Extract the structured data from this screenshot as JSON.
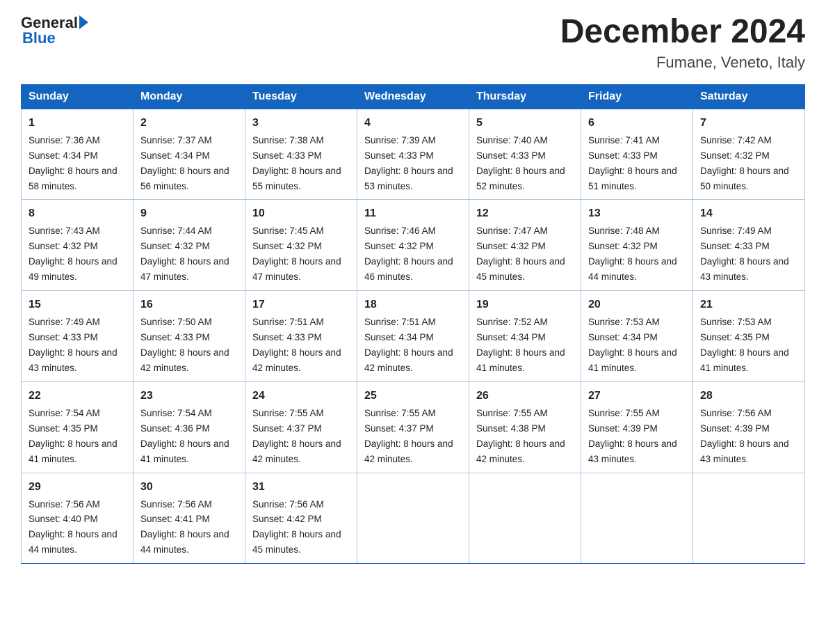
{
  "header": {
    "logo_general": "General",
    "logo_blue": "Blue",
    "month_title": "December 2024",
    "location": "Fumane, Veneto, Italy"
  },
  "weekdays": [
    "Sunday",
    "Monday",
    "Tuesday",
    "Wednesday",
    "Thursday",
    "Friday",
    "Saturday"
  ],
  "weeks": [
    [
      {
        "day": "1",
        "sunrise": "7:36 AM",
        "sunset": "4:34 PM",
        "daylight": "8 hours and 58 minutes."
      },
      {
        "day": "2",
        "sunrise": "7:37 AM",
        "sunset": "4:34 PM",
        "daylight": "8 hours and 56 minutes."
      },
      {
        "day": "3",
        "sunrise": "7:38 AM",
        "sunset": "4:33 PM",
        "daylight": "8 hours and 55 minutes."
      },
      {
        "day": "4",
        "sunrise": "7:39 AM",
        "sunset": "4:33 PM",
        "daylight": "8 hours and 53 minutes."
      },
      {
        "day": "5",
        "sunrise": "7:40 AM",
        "sunset": "4:33 PM",
        "daylight": "8 hours and 52 minutes."
      },
      {
        "day": "6",
        "sunrise": "7:41 AM",
        "sunset": "4:33 PM",
        "daylight": "8 hours and 51 minutes."
      },
      {
        "day": "7",
        "sunrise": "7:42 AM",
        "sunset": "4:32 PM",
        "daylight": "8 hours and 50 minutes."
      }
    ],
    [
      {
        "day": "8",
        "sunrise": "7:43 AM",
        "sunset": "4:32 PM",
        "daylight": "8 hours and 49 minutes."
      },
      {
        "day": "9",
        "sunrise": "7:44 AM",
        "sunset": "4:32 PM",
        "daylight": "8 hours and 47 minutes."
      },
      {
        "day": "10",
        "sunrise": "7:45 AM",
        "sunset": "4:32 PM",
        "daylight": "8 hours and 47 minutes."
      },
      {
        "day": "11",
        "sunrise": "7:46 AM",
        "sunset": "4:32 PM",
        "daylight": "8 hours and 46 minutes."
      },
      {
        "day": "12",
        "sunrise": "7:47 AM",
        "sunset": "4:32 PM",
        "daylight": "8 hours and 45 minutes."
      },
      {
        "day": "13",
        "sunrise": "7:48 AM",
        "sunset": "4:32 PM",
        "daylight": "8 hours and 44 minutes."
      },
      {
        "day": "14",
        "sunrise": "7:49 AM",
        "sunset": "4:33 PM",
        "daylight": "8 hours and 43 minutes."
      }
    ],
    [
      {
        "day": "15",
        "sunrise": "7:49 AM",
        "sunset": "4:33 PM",
        "daylight": "8 hours and 43 minutes."
      },
      {
        "day": "16",
        "sunrise": "7:50 AM",
        "sunset": "4:33 PM",
        "daylight": "8 hours and 42 minutes."
      },
      {
        "day": "17",
        "sunrise": "7:51 AM",
        "sunset": "4:33 PM",
        "daylight": "8 hours and 42 minutes."
      },
      {
        "day": "18",
        "sunrise": "7:51 AM",
        "sunset": "4:34 PM",
        "daylight": "8 hours and 42 minutes."
      },
      {
        "day": "19",
        "sunrise": "7:52 AM",
        "sunset": "4:34 PM",
        "daylight": "8 hours and 41 minutes."
      },
      {
        "day": "20",
        "sunrise": "7:53 AM",
        "sunset": "4:34 PM",
        "daylight": "8 hours and 41 minutes."
      },
      {
        "day": "21",
        "sunrise": "7:53 AM",
        "sunset": "4:35 PM",
        "daylight": "8 hours and 41 minutes."
      }
    ],
    [
      {
        "day": "22",
        "sunrise": "7:54 AM",
        "sunset": "4:35 PM",
        "daylight": "8 hours and 41 minutes."
      },
      {
        "day": "23",
        "sunrise": "7:54 AM",
        "sunset": "4:36 PM",
        "daylight": "8 hours and 41 minutes."
      },
      {
        "day": "24",
        "sunrise": "7:55 AM",
        "sunset": "4:37 PM",
        "daylight": "8 hours and 42 minutes."
      },
      {
        "day": "25",
        "sunrise": "7:55 AM",
        "sunset": "4:37 PM",
        "daylight": "8 hours and 42 minutes."
      },
      {
        "day": "26",
        "sunrise": "7:55 AM",
        "sunset": "4:38 PM",
        "daylight": "8 hours and 42 minutes."
      },
      {
        "day": "27",
        "sunrise": "7:55 AM",
        "sunset": "4:39 PM",
        "daylight": "8 hours and 43 minutes."
      },
      {
        "day": "28",
        "sunrise": "7:56 AM",
        "sunset": "4:39 PM",
        "daylight": "8 hours and 43 minutes."
      }
    ],
    [
      {
        "day": "29",
        "sunrise": "7:56 AM",
        "sunset": "4:40 PM",
        "daylight": "8 hours and 44 minutes."
      },
      {
        "day": "30",
        "sunrise": "7:56 AM",
        "sunset": "4:41 PM",
        "daylight": "8 hours and 44 minutes."
      },
      {
        "day": "31",
        "sunrise": "7:56 AM",
        "sunset": "4:42 PM",
        "daylight": "8 hours and 45 minutes."
      },
      null,
      null,
      null,
      null
    ]
  ]
}
